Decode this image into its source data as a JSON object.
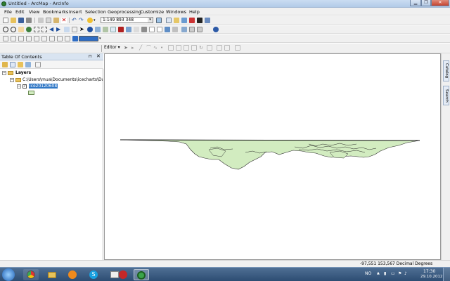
{
  "window": {
    "title": "Untitled - ArcMap - ArcInfo"
  },
  "menu": [
    "File",
    "Edit",
    "View",
    "Bookmarks",
    "Insert",
    "Selection",
    "Geoprocessing",
    "Customize",
    "Windows",
    "Help"
  ],
  "toolbar": {
    "scale_value": "1:149 893 348"
  },
  "editor": {
    "label": "Editor ▾"
  },
  "toc": {
    "title": "Table Of Contents",
    "layers_label": "Layers",
    "folder_path": "C:\\Users\\mua\\Documents\\icecharts\\Data\\I",
    "layer_name": "ice20120608"
  },
  "side_tabs": {
    "catalog": "Catalog",
    "search": "Search"
  },
  "status": {
    "coords": "-97,551  153,567 Decimal Degrees"
  },
  "taskbar": {
    "lang": "NO",
    "time": "17:30",
    "date": "29.10.2012"
  },
  "colors": {
    "polygon_fill": "#d2ecc0",
    "polygon_stroke": "#2a2a2a"
  }
}
